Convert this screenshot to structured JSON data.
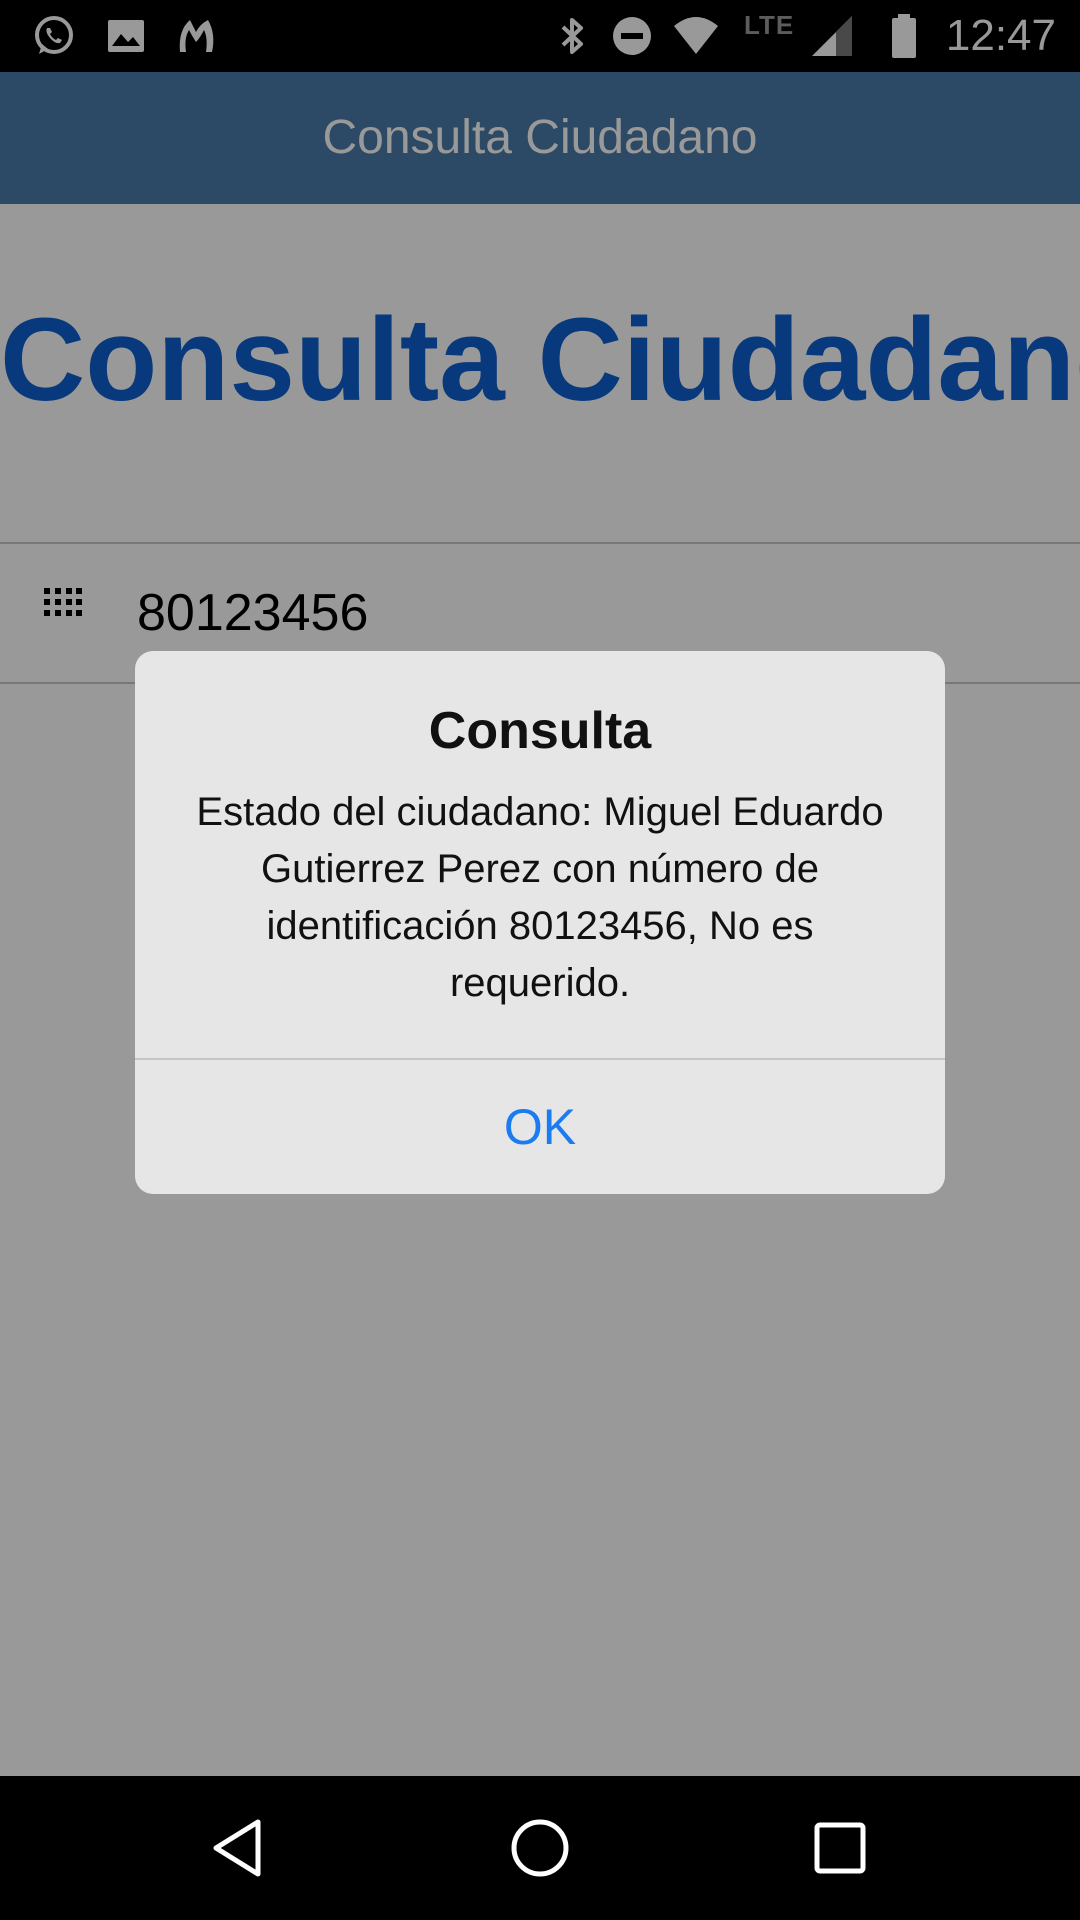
{
  "status_bar": {
    "time": "12:47",
    "network_label": "LTE",
    "icons": [
      "whatsapp-icon",
      "gallery-icon",
      "app-notification-icon",
      "bluetooth-icon",
      "do-not-disturb-icon",
      "wifi-icon",
      "signal-icon",
      "battery-icon"
    ]
  },
  "app_bar": {
    "title": "Consulta Ciudadano"
  },
  "page": {
    "headline": "Consulta Ciudadano",
    "id_field": {
      "value": "80123456",
      "icon": "keypad-icon"
    }
  },
  "dialog": {
    "title": "Consulta",
    "message": "Estado del ciudadano: Miguel Eduardo Gutierrez Perez con número de identificación 80123456, No es requerido.",
    "ok_label": "OK"
  },
  "nav_bar": {
    "buttons": [
      "back-icon",
      "home-icon",
      "recents-icon"
    ]
  },
  "colors": {
    "app_bar": "#4a7ca9",
    "headline": "#0d5fcf",
    "dialog_bg": "#e6e6e6",
    "ok_button": "#1a7cf0",
    "scrim": "rgba(0,0,0,0.40)"
  }
}
